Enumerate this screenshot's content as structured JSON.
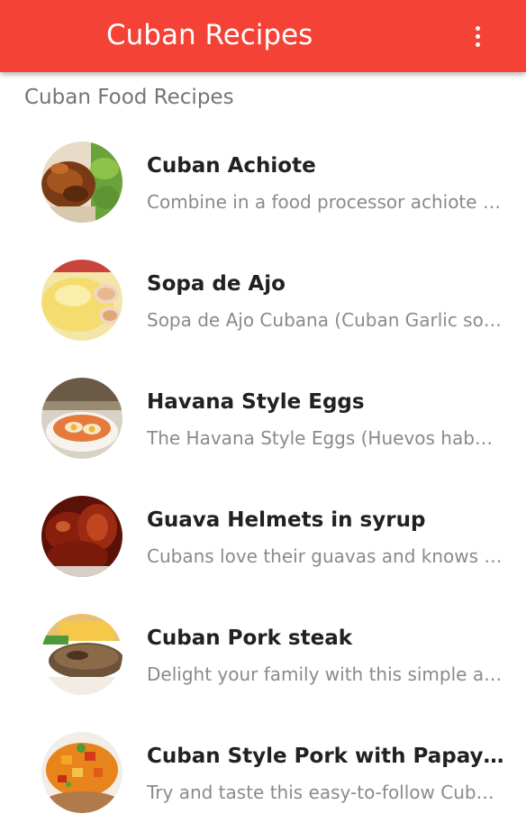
{
  "appbar": {
    "title": "Cuban Recipes",
    "background_color": "#f44336",
    "overflow_icon": "more-vert-icon"
  },
  "section": {
    "header": "Cuban Food Recipes"
  },
  "recipes": [
    {
      "title": "Cuban Achiote",
      "description": "Combine in a food processor achiote seeds and other ingredients",
      "image": "grilled-chicken-with-salad"
    },
    {
      "title": "Sopa de Ajo",
      "description": "Sopa de Ajo Cubana (Cuban Garlic soup)",
      "image": "garlic-soup-with-bread"
    },
    {
      "title": "Havana Style Eggs",
      "description": "The Havana Style Eggs (Huevos habaneros)",
      "image": "baked-eggs-in-dish"
    },
    {
      "title": "Guava Helmets in syrup",
      "description": "Cubans love their guavas and knows how to prepare them",
      "image": "guava-shells-in-syrup"
    },
    {
      "title": "Cuban Pork steak",
      "description": "Delight your family with this simple and tasty recipe",
      "image": "pork-steak-with-cheese"
    },
    {
      "title": "Cuban Style Pork with Papaya Salsa",
      "description": "Try and taste this easy-to-follow Cuban recipe",
      "image": "pork-with-papaya-salsa"
    }
  ]
}
